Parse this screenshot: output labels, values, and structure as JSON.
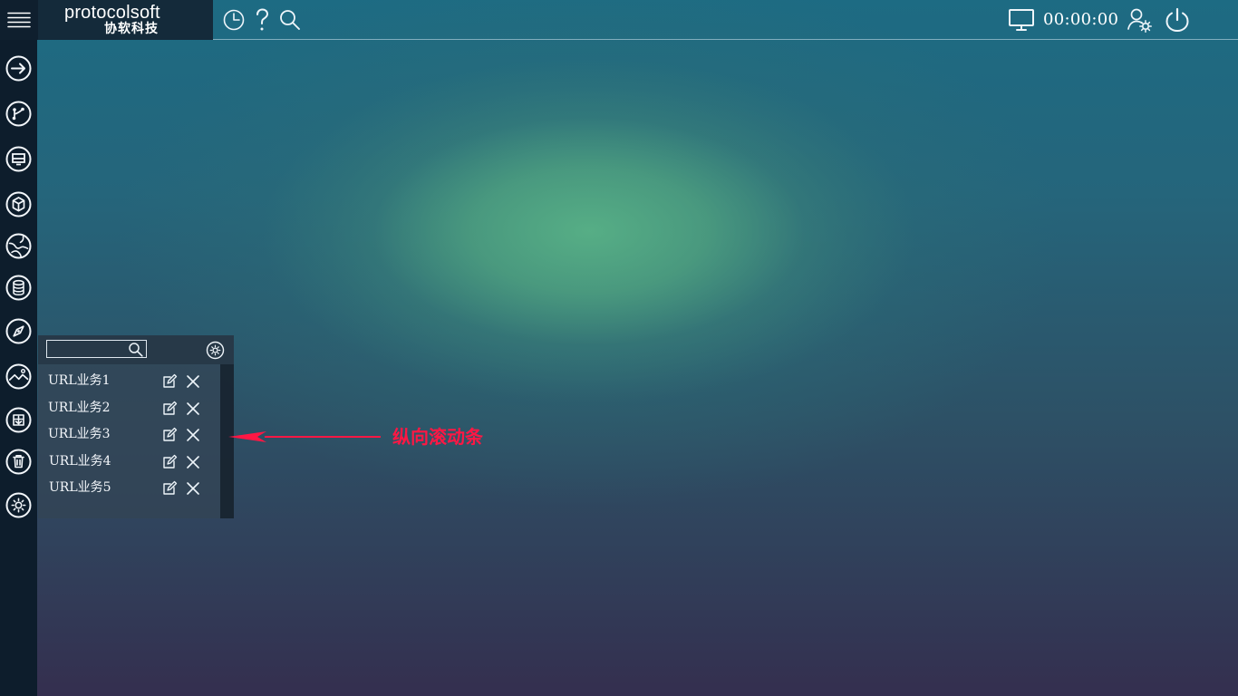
{
  "topbar": {
    "brand": "protocolsoft",
    "brand_sub": "协软科技",
    "timer": "00:00:00",
    "icons": [
      "menu-icon",
      "clock-icon",
      "help-icon",
      "search-icon",
      "monitor-icon",
      "user-settings-icon",
      "power-icon"
    ]
  },
  "sidebar": {
    "items": [
      "arrow-right-icon",
      "branch-icon",
      "monitor-icon",
      "cube-icon",
      "globe-icon",
      "database-icon",
      "compass-icon",
      "chart-icon",
      "download-box-icon",
      "trash-icon",
      "gear-icon"
    ]
  },
  "panel": {
    "search": {
      "value": "",
      "placeholder": ""
    },
    "items": [
      {
        "label": "URL业务1"
      },
      {
        "label": "URL业务2"
      },
      {
        "label": "URL业务3"
      },
      {
        "label": "URL业务4"
      },
      {
        "label": "URL业务5"
      }
    ]
  },
  "annotation": {
    "label": "纵向滚动条"
  },
  "colors": {
    "sidebar": "#0d1d2c",
    "logo_bg": "#142a3a",
    "annotation": "#ff1744",
    "text": "#f4f7fb"
  }
}
